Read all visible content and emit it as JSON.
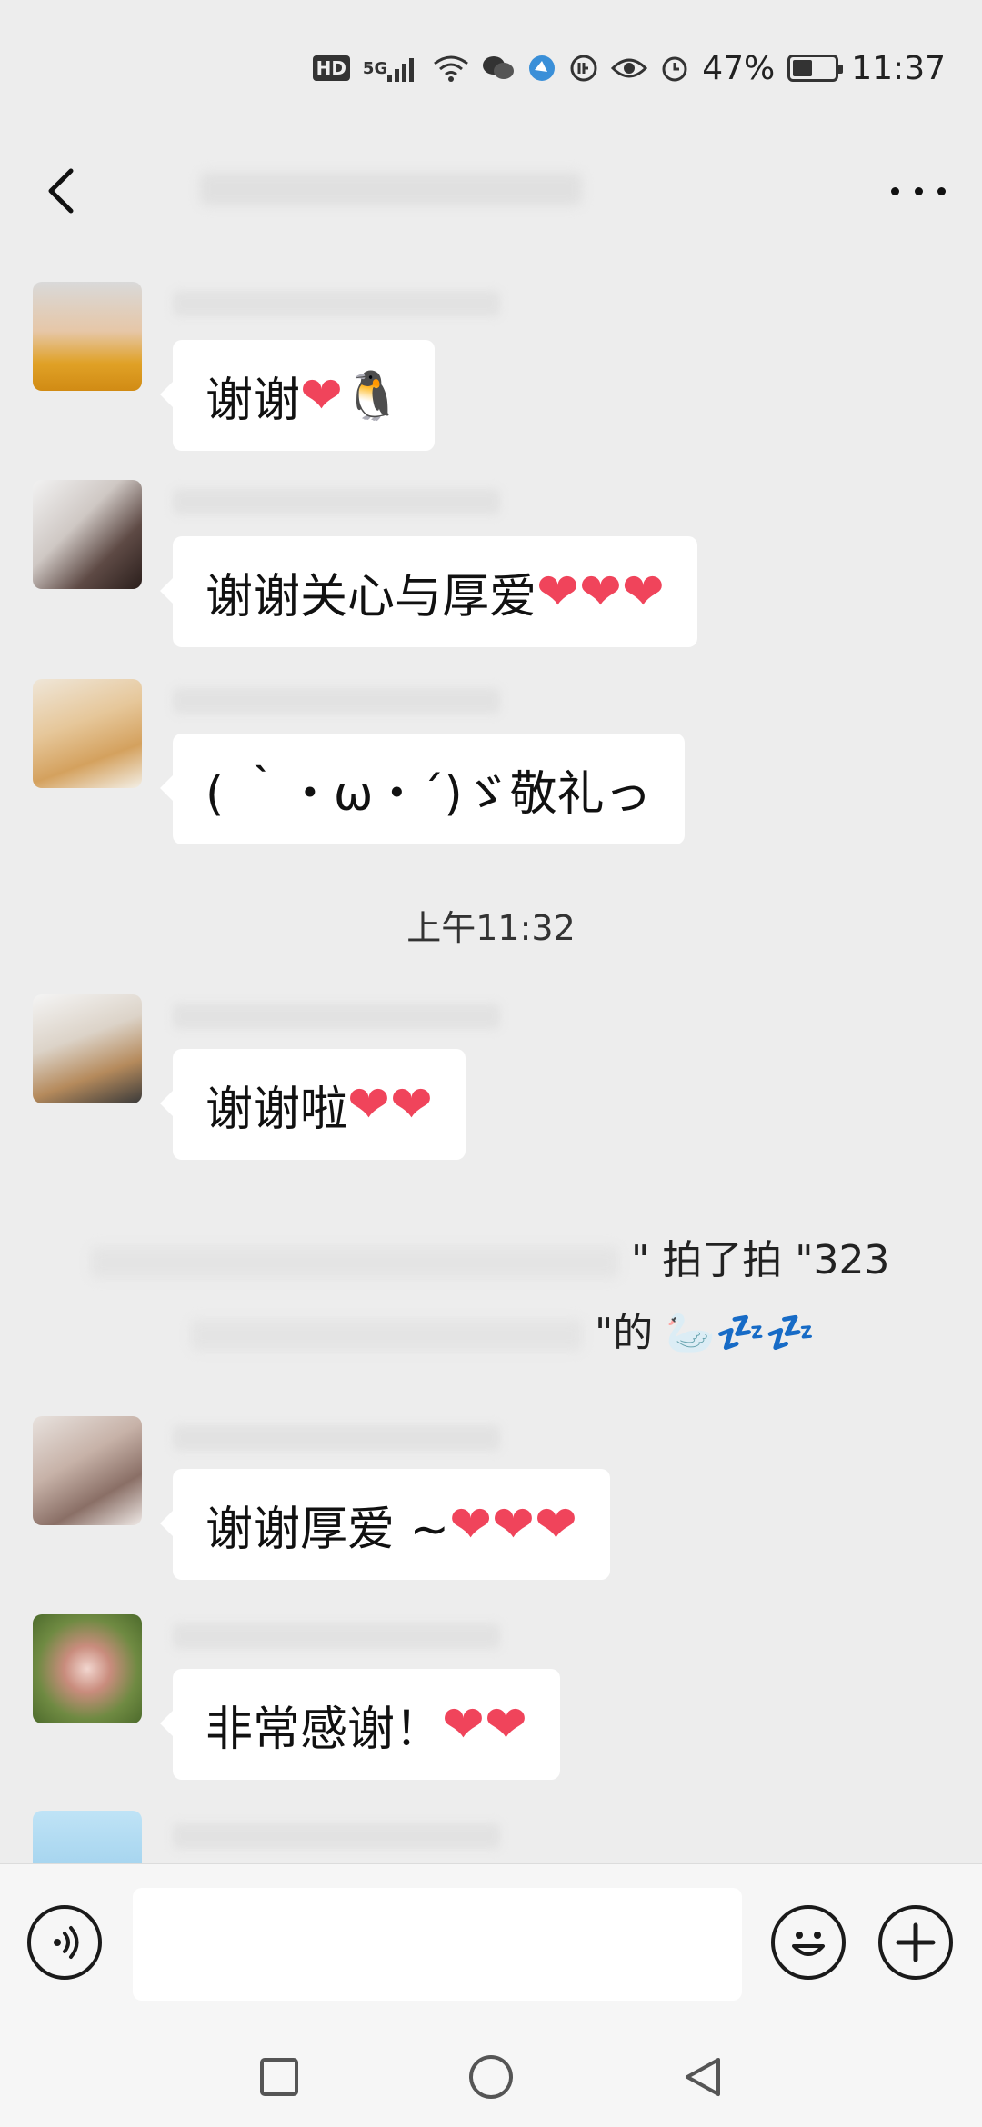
{
  "status_bar": {
    "hd": "HD",
    "network": "5G",
    "battery_percent": "47%",
    "battery_level": 0.47,
    "time": "11:37"
  },
  "nav": {
    "back_icon": "chevron-left-icon",
    "more_icon": "more-dots-icon"
  },
  "messages": [
    {
      "text": "谢谢",
      "hearts": "❤",
      "extra": "🐧",
      "avatar_color": "#d9a23a"
    },
    {
      "text": "谢谢关心与厚爱",
      "hearts": "❤❤❤",
      "avatar_color": "#6b5a55"
    },
    {
      "text": "( ｀・ω・´)ゞ敬礼っ",
      "hearts": "",
      "avatar_color": "#c9b27a"
    },
    {
      "text": "谢谢啦",
      "hearts": "❤❤",
      "avatar_color": "#9fb5c9"
    },
    {
      "text": "谢谢厚爱 ~ ",
      "hearts": "❤❤❤",
      "avatar_color": "#c8b6b0"
    },
    {
      "text": "非常感谢！",
      "hearts": "❤❤",
      "avatar_color": "#7c9a5a"
    }
  ],
  "time_label": "上午11:32",
  "pat": {
    "line1": "\" 拍了拍 \"323",
    "line2": "\"的",
    "icons": "🦢💤💤"
  },
  "input": {
    "voice_icon": "voice-icon",
    "emoji_icon": "emoji-icon",
    "plus_icon": "plus-icon",
    "value": ""
  },
  "system_nav": {
    "recent": "square-icon",
    "home": "circle-icon",
    "back": "triangle-back-icon"
  }
}
